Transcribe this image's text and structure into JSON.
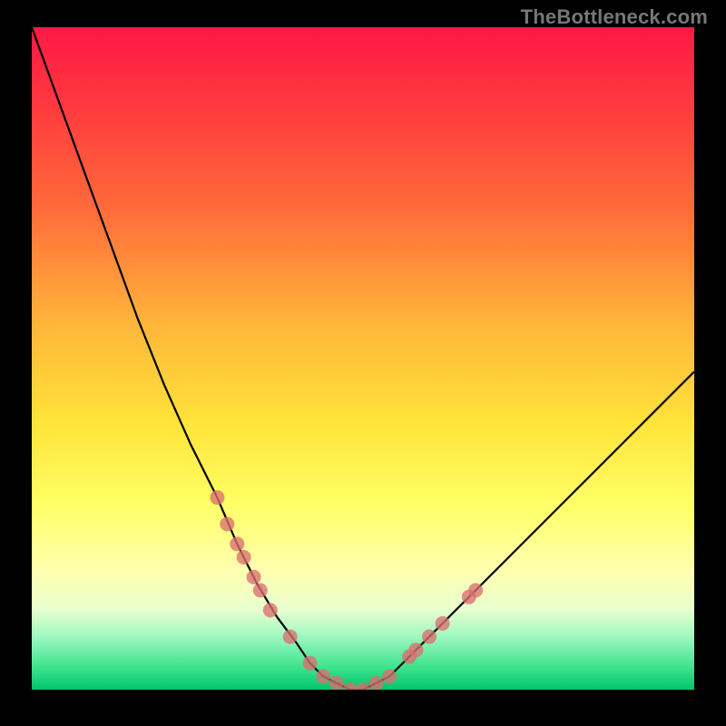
{
  "watermark": "TheBottleneck.com",
  "chart_data": {
    "type": "line",
    "title": "",
    "xlabel": "",
    "ylabel": "",
    "xlim": [
      0,
      100
    ],
    "ylim": [
      0,
      100
    ],
    "grid": false,
    "legend": false,
    "series": [
      {
        "name": "bottleneck-curve",
        "x": [
          0,
          4,
          8,
          12,
          16,
          20,
          24,
          28,
          31,
          34,
          37,
          40,
          42,
          44,
          46,
          48,
          50,
          52,
          54,
          57,
          61,
          66,
          72,
          79,
          86,
          93,
          100
        ],
        "y": [
          100,
          89,
          78,
          67,
          56,
          46,
          37,
          29,
          22,
          16,
          11,
          7,
          4,
          2,
          1,
          0,
          0,
          1,
          2,
          5,
          9,
          14,
          20,
          27,
          34,
          41,
          48
        ]
      }
    ],
    "markers": {
      "name": "highlight-points",
      "points": [
        {
          "x": 28,
          "y": 29
        },
        {
          "x": 29.5,
          "y": 25
        },
        {
          "x": 31,
          "y": 22
        },
        {
          "x": 32,
          "y": 20
        },
        {
          "x": 33.5,
          "y": 17
        },
        {
          "x": 34.5,
          "y": 15
        },
        {
          "x": 36,
          "y": 12
        },
        {
          "x": 39,
          "y": 8
        },
        {
          "x": 42,
          "y": 4
        },
        {
          "x": 44,
          "y": 2
        },
        {
          "x": 46,
          "y": 1
        },
        {
          "x": 48,
          "y": 0
        },
        {
          "x": 50,
          "y": 0
        },
        {
          "x": 52,
          "y": 1
        },
        {
          "x": 54,
          "y": 2
        },
        {
          "x": 57,
          "y": 5
        },
        {
          "x": 58,
          "y": 6
        },
        {
          "x": 60,
          "y": 8
        },
        {
          "x": 62,
          "y": 10
        },
        {
          "x": 66,
          "y": 14
        },
        {
          "x": 67,
          "y": 15
        }
      ]
    },
    "colors": {
      "curve": "#000000",
      "markers": "#d97070",
      "gradient_top": "#ff1846",
      "gradient_bottom": "#00c46a"
    }
  }
}
